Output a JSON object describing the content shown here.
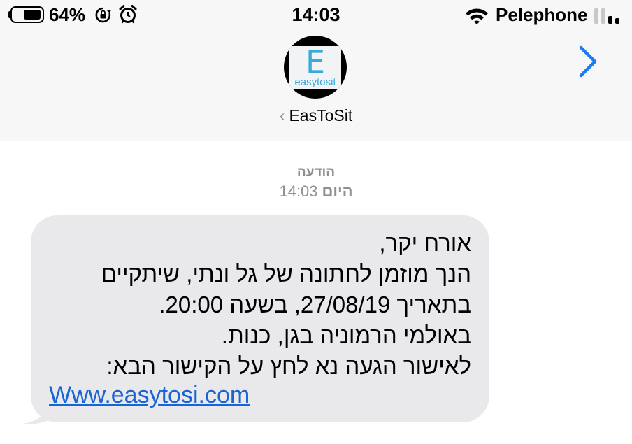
{
  "status_bar": {
    "battery_percent": "64%",
    "battery_level": 0.64,
    "time": "14:03",
    "carrier": "Pelephone",
    "icons": [
      "battery-icon",
      "rotation-lock-icon",
      "alarm-icon",
      "wifi-icon",
      "cellular-signal-icon"
    ]
  },
  "contact": {
    "name": "EasToSit",
    "avatar_letter": "E",
    "avatar_brand": "easytosit"
  },
  "message_header": {
    "title": "הודעה",
    "day": "היום",
    "time": "14:03"
  },
  "message": {
    "lines": [
      "אורח יקר,",
      "הנך מוזמן לחתונה של גל ונתי, שיתקיים",
      "בתאריך 27/08/19, בשעה 20:00.",
      "באולמי הרמוניה בגן, כנות.",
      "לאישור הגעה נא לחץ על הקישור הבא:"
    ],
    "link": "Www.easytosi.com"
  },
  "colors": {
    "header_bg": "#f7f7f7",
    "bubble_bg": "#e9e9eb",
    "link": "#1a65d6",
    "accent": "#1a7cf5",
    "secondary_text": "#8e8e93"
  }
}
